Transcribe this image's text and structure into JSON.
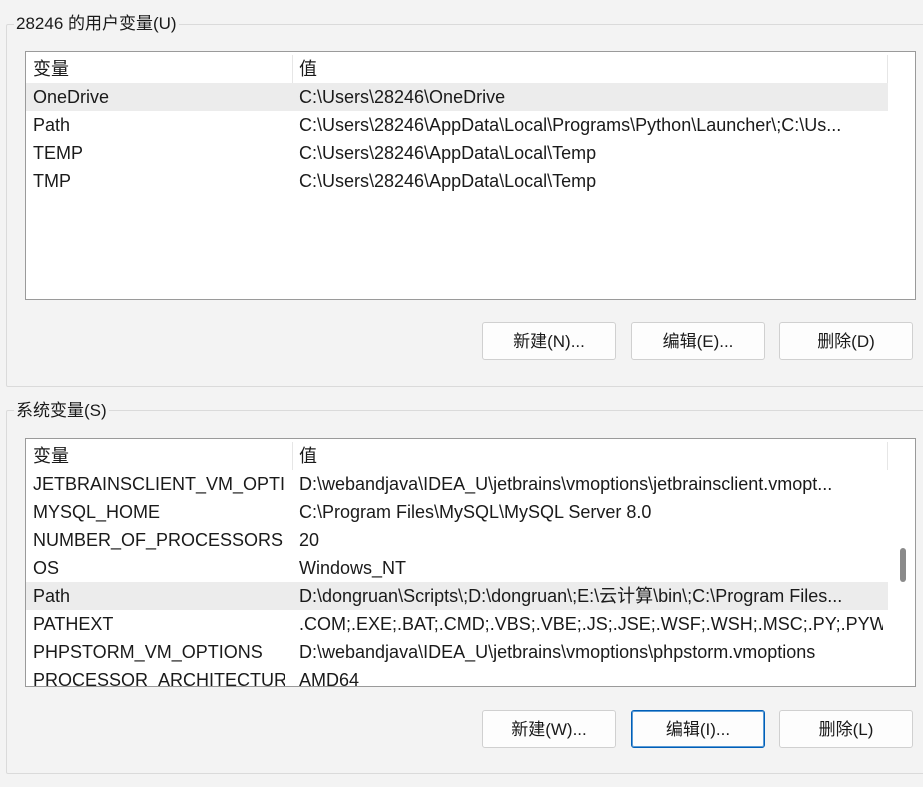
{
  "user_group": {
    "title": "28246 的用户变量(U)",
    "columns": {
      "name": "变量",
      "value": "值"
    },
    "rows": [
      {
        "name": "OneDrive",
        "value": "C:\\Users\\28246\\OneDrive"
      },
      {
        "name": "Path",
        "value": "C:\\Users\\28246\\AppData\\Local\\Programs\\Python\\Launcher\\;C:\\Us..."
      },
      {
        "name": "TEMP",
        "value": "C:\\Users\\28246\\AppData\\Local\\Temp"
      },
      {
        "name": "TMP",
        "value": "C:\\Users\\28246\\AppData\\Local\\Temp"
      }
    ],
    "selected_index": 0,
    "buttons": {
      "new": "新建(N)...",
      "edit": "编辑(E)...",
      "delete": "删除(D)"
    }
  },
  "system_group": {
    "title": "系统变量(S)",
    "columns": {
      "name": "变量",
      "value": "值"
    },
    "rows": [
      {
        "name": "JETBRAINSCLIENT_VM_OPTI...",
        "value": "D:\\webandjava\\IDEA_U\\jetbrains\\vmoptions\\jetbrainsclient.vmopt..."
      },
      {
        "name": "MYSQL_HOME",
        "value": "C:\\Program Files\\MySQL\\MySQL Server 8.0"
      },
      {
        "name": "NUMBER_OF_PROCESSORS",
        "value": "20"
      },
      {
        "name": "OS",
        "value": "Windows_NT"
      },
      {
        "name": "Path",
        "value": "D:\\dongruan\\Scripts\\;D:\\dongruan\\;E:\\云计算\\bin\\;C:\\Program Files..."
      },
      {
        "name": "PATHEXT",
        "value": ".COM;.EXE;.BAT;.CMD;.VBS;.VBE;.JS;.JSE;.WSF;.WSH;.MSC;.PY;.PYW"
      },
      {
        "name": "PHPSTORM_VM_OPTIONS",
        "value": "D:\\webandjava\\IDEA_U\\jetbrains\\vmoptions\\phpstorm.vmoptions"
      },
      {
        "name": "PROCESSOR_ARCHITECTURE",
        "value": "AMD64"
      }
    ],
    "selected_index": 4,
    "buttons": {
      "new": "新建(W)...",
      "edit": "编辑(I)...",
      "delete": "删除(L)"
    }
  }
}
